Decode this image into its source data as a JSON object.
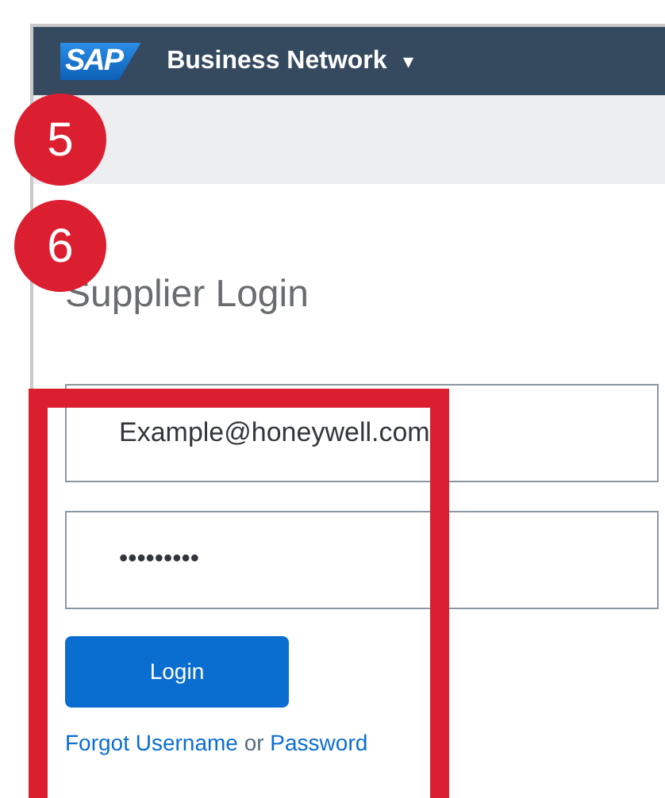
{
  "navbar": {
    "logo_text": "SAP",
    "product": "Business Network",
    "caret": "▾"
  },
  "callouts": [
    {
      "label": "5"
    },
    {
      "label": "6"
    }
  ],
  "title": "Supplier Login",
  "login_form": {
    "username": {
      "value": "Example@honeywell.com"
    },
    "password": {
      "value": "•••••••••"
    },
    "button": "Login",
    "help_links": [
      {
        "kind": "link",
        "text": "Forgot Username"
      },
      {
        "kind": "text",
        "text": "or"
      },
      {
        "kind": "link",
        "text": "Password"
      }
    ]
  }
}
